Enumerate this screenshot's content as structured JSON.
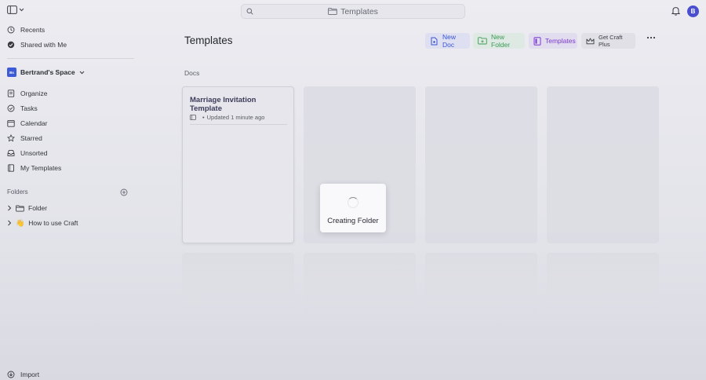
{
  "topbar": {
    "search_label": "Templates",
    "avatar_initial": "B"
  },
  "sidebar": {
    "top_items": [
      {
        "label": "Recents",
        "icon": "clock-icon"
      },
      {
        "label": "Shared with Me",
        "icon": "shared-icon"
      }
    ],
    "space": {
      "badge": "Bs",
      "name": "Bertrand's Space"
    },
    "nav_items": [
      {
        "label": "Organize",
        "icon": "organize-icon"
      },
      {
        "label": "Tasks",
        "icon": "check-circle-icon"
      },
      {
        "label": "Calendar",
        "icon": "calendar-icon"
      },
      {
        "label": "Starred",
        "icon": "star-icon"
      },
      {
        "label": "Unsorted",
        "icon": "tray-icon"
      },
      {
        "label": "My Templates",
        "icon": "template-icon"
      }
    ],
    "folders_label": "Folders",
    "folders": [
      {
        "label": "Folder",
        "icon": "folder-icon"
      },
      {
        "label": "How to use Craft",
        "icon": "wave-hand-icon",
        "emoji": "👋"
      }
    ],
    "import_label": "Import"
  },
  "main": {
    "title": "Templates",
    "actions": {
      "new_doc": "New Doc",
      "new_folder": "New Folder",
      "templates": "Templates",
      "get_plus": "Get Craft Plus"
    },
    "section_label": "Docs",
    "card": {
      "title": "Marriage Invitation Template",
      "bullet": "•",
      "updated": "Updated 1 minute ago"
    }
  },
  "modal": {
    "text": "Creating Folder"
  },
  "colors": {
    "doc_accent": "#3a56d4",
    "folder_accent": "#3c9a56",
    "templates_accent": "#7a3ad0",
    "avatar": "#4a4fcf"
  }
}
